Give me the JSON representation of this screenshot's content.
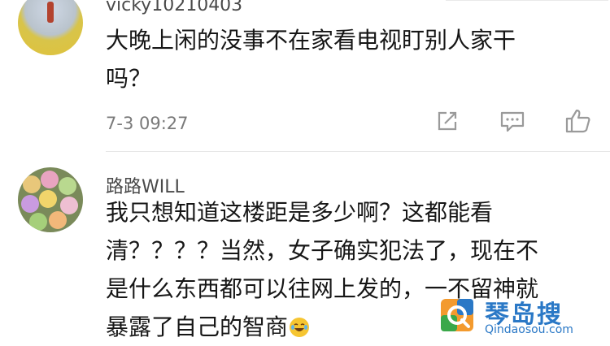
{
  "comments": [
    {
      "username": "vicky10210403",
      "text_lines": [
        "大晚上闲的没事不在家看电视盯别人家干",
        "吗？"
      ],
      "timestamp": "7-3 09:27",
      "actions": [
        "share-icon",
        "reply-icon",
        "like-icon"
      ]
    },
    {
      "username": "路路WILL",
      "text_lines": [
        "我只想知道这楼距是多少啊？这都能看",
        "清？？？？当然，女子确实犯法了，现在不",
        "是什么东西都可以往网上发的，一不留神就",
        "暴露了自己的智商"
      ],
      "emoji": "laughing-crying-emoji"
    }
  ],
  "watermark": {
    "name": "琴岛搜",
    "url": "Qindaosou.com"
  },
  "colors": {
    "username": "#4a4a4a",
    "timestamp": "#7a7a7a",
    "watermark": "#2a78c6"
  }
}
